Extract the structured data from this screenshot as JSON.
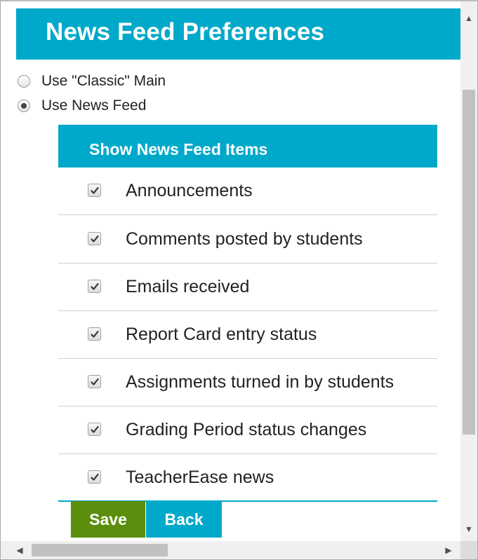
{
  "header": {
    "title": "News Feed Preferences"
  },
  "view_mode": {
    "options": [
      {
        "label": "Use \"Classic\" Main",
        "selected": false
      },
      {
        "label": "Use News Feed",
        "selected": true
      }
    ]
  },
  "panel": {
    "title": "Show News Feed Items",
    "items": [
      {
        "label": "Announcements",
        "checked": true
      },
      {
        "label": "Comments posted by students",
        "checked": true
      },
      {
        "label": "Emails received",
        "checked": true
      },
      {
        "label": "Report Card entry status",
        "checked": true
      },
      {
        "label": "Assignments turned in by students",
        "checked": true
      },
      {
        "label": "Grading Period status changes",
        "checked": true
      },
      {
        "label": "TeacherEase news",
        "checked": true
      }
    ]
  },
  "buttons": {
    "save_label": "Save",
    "back_label": "Back"
  },
  "colors": {
    "accent": "#00a9c9",
    "save": "#5b8e0c",
    "text": "#222222"
  },
  "icons": {
    "scroll_up": "triangle-up-icon",
    "scroll_down": "triangle-down-icon",
    "scroll_left": "triangle-left-icon",
    "scroll_right": "triangle-right-icon",
    "check": "checkmark-icon"
  }
}
